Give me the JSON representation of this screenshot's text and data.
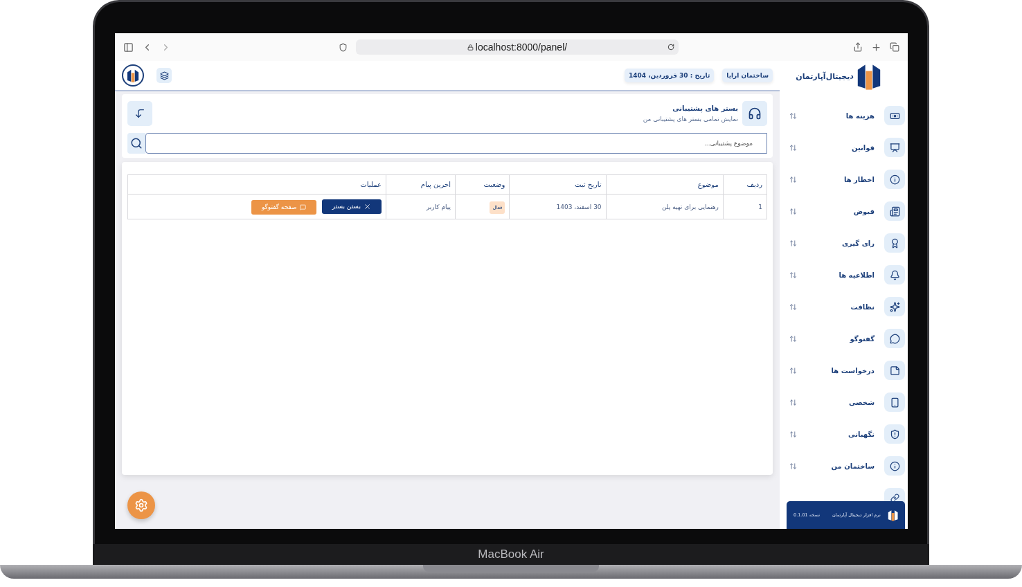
{
  "browser": {
    "url": "localhost:8000/panel/"
  },
  "header": {
    "brand": "دیجیتال‌آپارتمان",
    "building": "ساختمان ارایا",
    "date": "تاریخ : 30 فروردین، 1404"
  },
  "page": {
    "title": "بستر های پشتیبانی",
    "subtitle": "نمایش تمامی بستر های پشتیبانی من",
    "search_placeholder": "موضوع پشتیبانی..."
  },
  "table": {
    "columns": [
      "ردیف",
      "موضوع",
      "تاریخ ثبت",
      "وضعیت",
      "اخرین پیام",
      "عملیات"
    ],
    "rows": [
      {
        "index": "1",
        "subject": "رهنمایی برای تهیه پلن",
        "date": "30 اسفند، 1403",
        "status": "فعال",
        "last_message": "پیام کاربر",
        "actions": [
          {
            "kind": "close",
            "label": "بستن بستر"
          },
          {
            "kind": "chat",
            "label": "صفحه گفتوگو"
          }
        ]
      }
    ]
  },
  "sidebar": {
    "items": [
      {
        "label": "هزینه ها"
      },
      {
        "label": "قوانین"
      },
      {
        "label": "اخطار ها"
      },
      {
        "label": "قبوض"
      },
      {
        "label": "رای گیری"
      },
      {
        "label": "اطلاعیه ها"
      },
      {
        "label": "نظافت"
      },
      {
        "label": "گفتوگو"
      },
      {
        "label": "درخواست ها"
      },
      {
        "label": "شخصی"
      },
      {
        "label": "نگهبانی"
      },
      {
        "label": "ساختمان من"
      }
    ],
    "footer": {
      "app": "نرم افزار دیجیتال آپارتمان",
      "version": "نسخه 0.1.01"
    }
  },
  "device": {
    "name": "MacBook Air"
  }
}
